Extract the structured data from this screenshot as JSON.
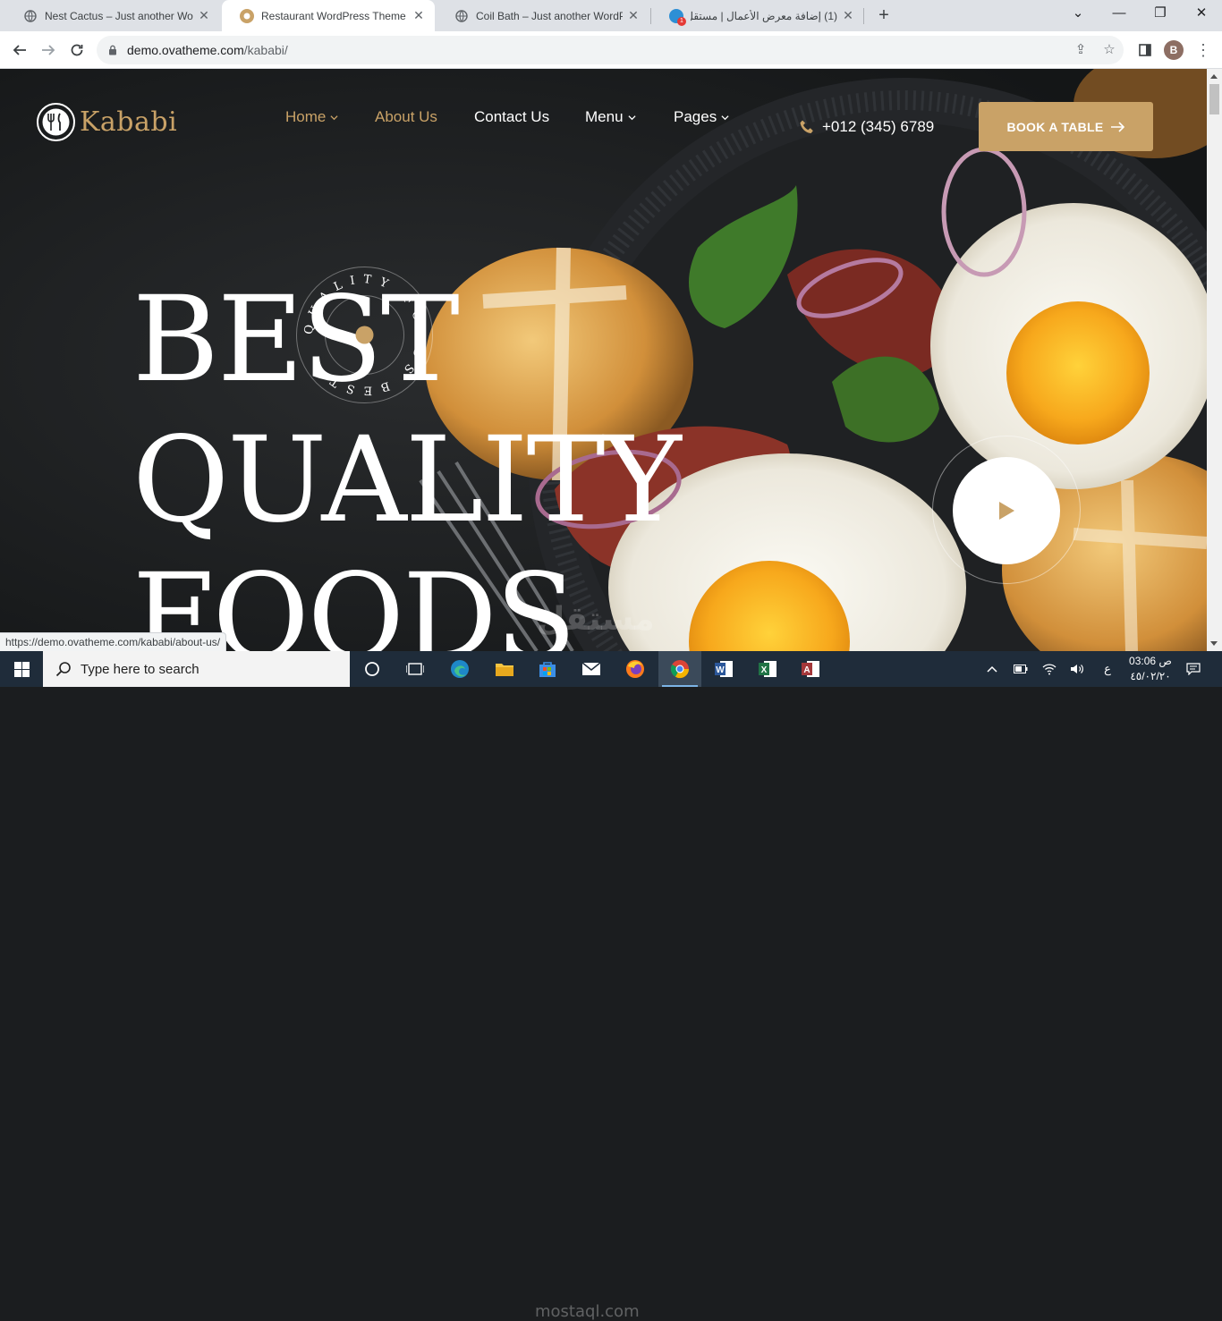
{
  "browser": {
    "tabs": [
      {
        "title": "Nest Cactus – Just another WordPress site",
        "favicon": "globe-icon",
        "active": false
      },
      {
        "title": "Restaurant WordPress Theme – Kababi",
        "favicon": "kababi-icon",
        "active": true
      },
      {
        "title": "Coil Bath – Just another WordPress site",
        "favicon": "globe-icon",
        "active": false
      },
      {
        "title": "(1) إضافة معرض الأعمال | مستقل",
        "favicon": "mostaql-icon",
        "badge": "1",
        "active": false
      }
    ],
    "new_tab": "+",
    "url_host": "demo.ovatheme.com",
    "url_path": "/kababi/",
    "profile_initial": "B",
    "status_url": "https://demo.ovatheme.com/kababi/about-us/"
  },
  "site": {
    "logo_text": "Kababi",
    "nav": {
      "home": "Home",
      "about": "About Us",
      "contact": "Contact Us",
      "menu": "Menu",
      "pages": "Pages"
    },
    "phone": "+012 (345) 6789",
    "book_button": "BOOK A TABLE",
    "hero": {
      "line1": "BEST",
      "line2": "QUALITY",
      "line3": "FOODS"
    },
    "badge_text": "QUALITY FOODS BEST"
  },
  "taskbar": {
    "search_placeholder": "Type here to search",
    "clock_time": "03:06 ص",
    "clock_date": "٤٥/٠٢/٢٠",
    "lang": "ع"
  },
  "watermark": {
    "arabic": "مستقل",
    "latin": "mostaql.com"
  },
  "colors": {
    "accent": "#c9a267",
    "hero_text": "#ffffff",
    "taskbar": "#1f2c3a"
  }
}
